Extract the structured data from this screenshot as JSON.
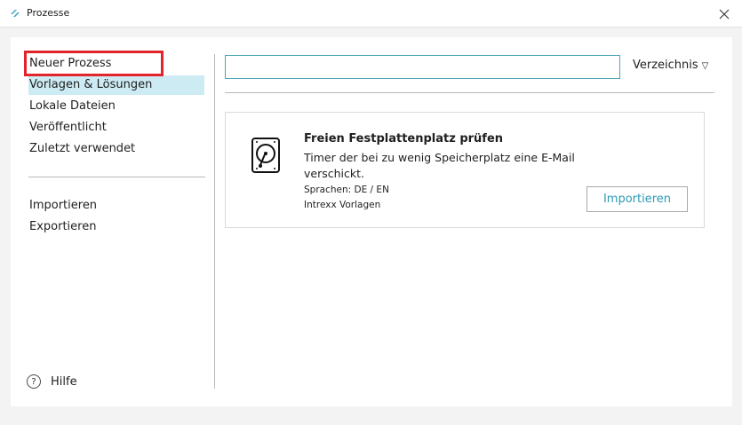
{
  "window": {
    "title": "Prozesse",
    "accent": "#2e9ab3"
  },
  "nav": {
    "items": [
      {
        "label": "Neuer Prozess"
      },
      {
        "label": "Vorlagen & Lösungen"
      },
      {
        "label": "Lokale Dateien"
      },
      {
        "label": "Veröffentlicht"
      },
      {
        "label": "Zuletzt verwendet"
      }
    ],
    "actions": [
      {
        "label": "Importieren"
      },
      {
        "label": "Exportieren"
      }
    ],
    "help_label": "Hilfe",
    "help_glyph": "?",
    "selected_index": 1
  },
  "search": {
    "value": "",
    "placeholder": ""
  },
  "directory_dropdown": {
    "label": "Verzeichnis",
    "arrow": "▽"
  },
  "template_card": {
    "icon": "hard-disk-icon",
    "title": "Freien Festplattenplatz prüfen",
    "description": "Timer der bei zu wenig Speicherplatz eine E-Mail verschickt.",
    "languages": "Sprachen:  DE / EN",
    "source": "Intrexx Vorlagen",
    "import_label": "Importieren"
  }
}
